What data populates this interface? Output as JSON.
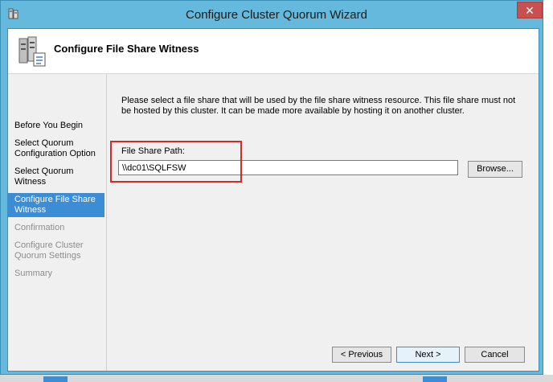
{
  "window": {
    "title": "Configure Cluster Quorum Wizard",
    "close_symbol": "✕"
  },
  "header": {
    "title": "Configure File Share Witness",
    "icon": "cluster-server-icon"
  },
  "steps": [
    {
      "label": "Before You Begin",
      "state": "normal"
    },
    {
      "label": "Select Quorum Configuration Option",
      "state": "normal"
    },
    {
      "label": "Select Quorum Witness",
      "state": "normal"
    },
    {
      "label": "Configure File Share Witness",
      "state": "active"
    },
    {
      "label": "Confirmation",
      "state": "disabled"
    },
    {
      "label": "Configure Cluster Quorum Settings",
      "state": "disabled"
    },
    {
      "label": "Summary",
      "state": "disabled"
    }
  ],
  "main": {
    "description": "Please select a file share that will be used by the file share witness resource.  This file share must not be hosted by this cluster.  It can be made more available by hosting it on another cluster.",
    "field_label": "File Share Path:",
    "path_value": "\\\\dc01\\SQLFSW",
    "browse_label": "Browse..."
  },
  "buttons": {
    "previous": "< Previous",
    "next": "Next >",
    "cancel": "Cancel"
  },
  "colors": {
    "titlebar": "#64b9dc",
    "active_step": "#3c8cd6",
    "highlight": "#d42a2a",
    "close": "#c75050"
  }
}
